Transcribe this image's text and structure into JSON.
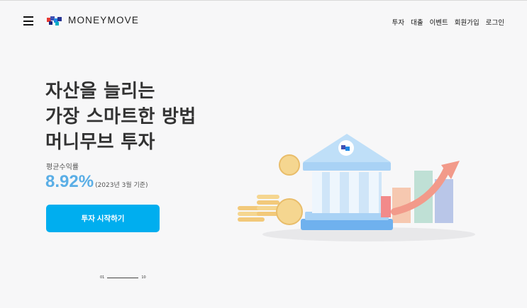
{
  "header": {
    "logo_text": "MONEYMOVE",
    "nav": [
      "투자",
      "대출",
      "이벤트",
      "회원가입",
      "로그인"
    ]
  },
  "hero": {
    "headline": [
      "자산을 늘리는",
      "가장 스마트한 방법",
      "머니무브 투자"
    ],
    "yield_label": "평균수익률",
    "yield_value": "8.92%",
    "yield_note": "(2023년 3월 기준)",
    "cta_label": "투자 시작하기"
  },
  "slider": {
    "current": "01",
    "total": "10",
    "progress": 0.1
  },
  "colors": {
    "accent": "#00aeef",
    "yield": "#5aaee6"
  }
}
